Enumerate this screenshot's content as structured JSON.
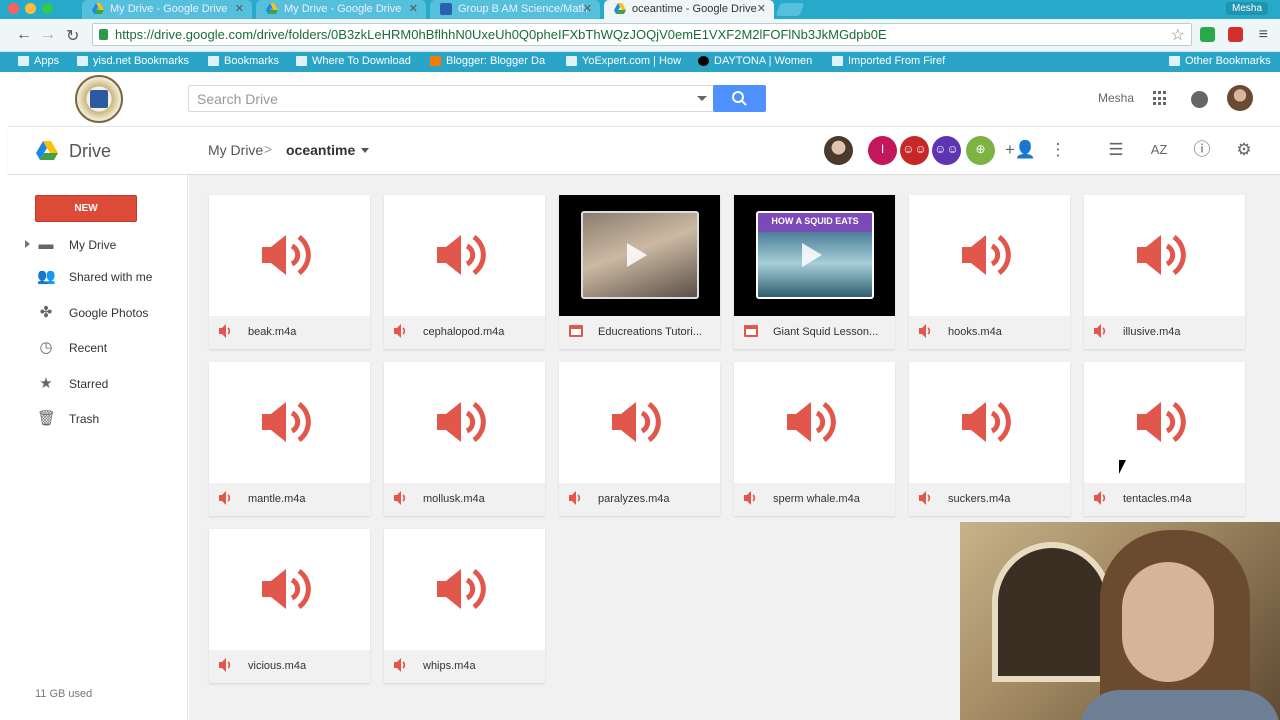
{
  "browser": {
    "tabs": [
      {
        "title": "My Drive - Google Drive",
        "active": false
      },
      {
        "title": "My Drive - Google Drive",
        "active": false
      },
      {
        "title": "Group B AM Science/Math",
        "active": false
      },
      {
        "title": "oceantime - Google Drive",
        "active": true
      }
    ],
    "profile_name": "Mesha",
    "url": "https://drive.google.com/drive/folders/0B3zkLeHRM0hBflhhN0UxeUh0Q0pheIFXbThWQzJOQjV0emE1VXF2M2lFOFlNb3JkMGdpb0E",
    "bookmarks": [
      "Apps",
      "yisd.net Bookmarks",
      "Bookmarks",
      "Where To Download",
      "Blogger: Blogger Da",
      "YoExpert.com | How",
      "DAYTONA | Women",
      "Imported From Firef",
      "Other Bookmarks"
    ]
  },
  "drive": {
    "search_placeholder": "Search Drive",
    "user_name": "Mesha",
    "app_title": "Drive",
    "breadcrumb": {
      "root": "My Drive",
      "separator": ">",
      "current": "oceantime"
    },
    "share_avatars": [
      {
        "glyph": "I",
        "color": "#c2185b"
      },
      {
        "glyph": "☺☺",
        "color": "#c62828"
      },
      {
        "glyph": "☺☺",
        "color": "#5e35b1"
      },
      {
        "glyph": "⊕",
        "color": "#7cb342"
      }
    ],
    "sidebar": {
      "new_label": "NEW",
      "items": [
        {
          "label": "My Drive",
          "icon": "folder-icon"
        },
        {
          "label": "Shared with me",
          "icon": "people-icon"
        },
        {
          "label": "Google Photos",
          "icon": "pinwheel-icon"
        },
        {
          "label": "Recent",
          "icon": "clock-icon"
        },
        {
          "label": "Starred",
          "icon": "star-icon"
        },
        {
          "label": "Trash",
          "icon": "trash-icon"
        }
      ],
      "storage": "11 GB used"
    },
    "files": [
      {
        "name": "beak.m4a",
        "type": "audio"
      },
      {
        "name": "cephalopod.m4a",
        "type": "audio"
      },
      {
        "name": "Educreations Tutori...",
        "type": "video"
      },
      {
        "name": "Giant Squid Lesson...",
        "type": "video",
        "thumb_title": "HOW A SQUID EATS"
      },
      {
        "name": "hooks.m4a",
        "type": "audio"
      },
      {
        "name": "illusive.m4a",
        "type": "audio"
      },
      {
        "name": "mantle.m4a",
        "type": "audio"
      },
      {
        "name": "mollusk.m4a",
        "type": "audio"
      },
      {
        "name": "paralyzes.m4a",
        "type": "audio"
      },
      {
        "name": "sperm whale.m4a",
        "type": "audio"
      },
      {
        "name": "suckers.m4a",
        "type": "audio"
      },
      {
        "name": "tentacles.m4a",
        "type": "audio"
      },
      {
        "name": "vicious.m4a",
        "type": "audio"
      },
      {
        "name": "whips.m4a",
        "type": "audio"
      }
    ]
  },
  "colors": {
    "accent_red": "#dc4a38",
    "audio_red": "#e2574c",
    "search_blue": "#4d90fe"
  }
}
